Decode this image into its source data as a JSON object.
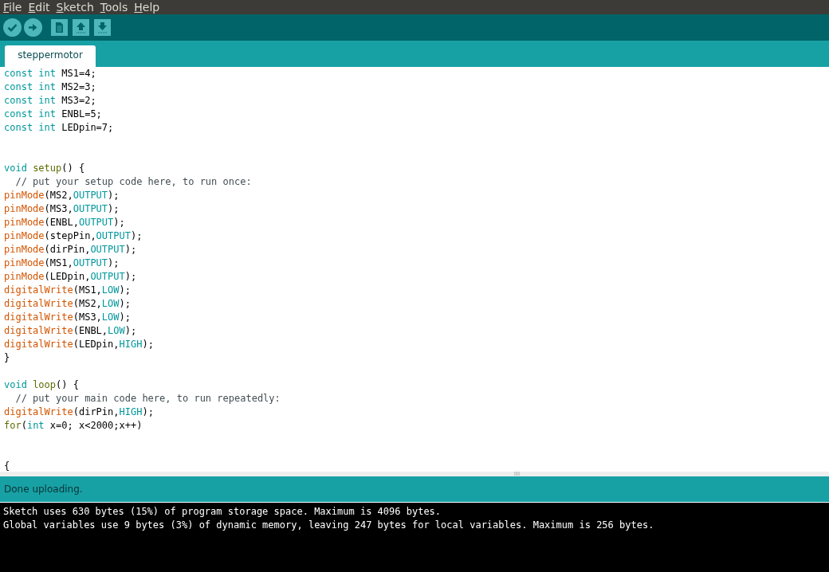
{
  "menu": [
    {
      "label": "File"
    },
    {
      "label": "Edit"
    },
    {
      "label": "Sketch"
    },
    {
      "label": "Tools"
    },
    {
      "label": "Help"
    }
  ],
  "toolbar": [
    {
      "kind": "verify"
    },
    {
      "kind": "upload"
    },
    {
      "kind": "new"
    },
    {
      "kind": "open"
    },
    {
      "kind": "save"
    }
  ],
  "tabs": [
    {
      "label": "steppermotor",
      "selected": true
    }
  ],
  "editor": {
    "lines": [
      {
        "kind": "code",
        "tokens": [
          {
            "kind": "keyword",
            "text": "const int"
          },
          {
            "kind": "plain",
            "text": " MS1=4;"
          }
        ]
      },
      {
        "kind": "code",
        "tokens": [
          {
            "kind": "keyword",
            "text": "const int"
          },
          {
            "kind": "plain",
            "text": " MS2=3;"
          }
        ]
      },
      {
        "kind": "code",
        "tokens": [
          {
            "kind": "keyword",
            "text": "const int"
          },
          {
            "kind": "plain",
            "text": " MS3=2;"
          }
        ]
      },
      {
        "kind": "code",
        "tokens": [
          {
            "kind": "keyword",
            "text": "const int"
          },
          {
            "kind": "plain",
            "text": " ENBL=5;"
          }
        ]
      },
      {
        "kind": "code",
        "tokens": [
          {
            "kind": "keyword",
            "text": "const int"
          },
          {
            "kind": "plain",
            "text": " LEDpin=7;"
          }
        ]
      },
      {
        "kind": "blank"
      },
      {
        "kind": "blank"
      },
      {
        "kind": "code",
        "tokens": [
          {
            "kind": "keyword",
            "text": "void"
          },
          {
            "kind": "structure",
            "text": " setup"
          },
          {
            "kind": "plain",
            "text": "() {"
          }
        ]
      },
      {
        "kind": "code",
        "tokens": [
          {
            "kind": "comment",
            "text": "  // put your setup code here, to run once:"
          }
        ]
      },
      {
        "kind": "code",
        "tokens": [
          {
            "kind": "function",
            "text": "pinMode"
          },
          {
            "kind": "plain",
            "text": "(MS2,"
          },
          {
            "kind": "constant",
            "text": "OUTPUT"
          },
          {
            "kind": "plain",
            "text": ");"
          }
        ]
      },
      {
        "kind": "code",
        "tokens": [
          {
            "kind": "function",
            "text": "pinMode"
          },
          {
            "kind": "plain",
            "text": "(MS3,"
          },
          {
            "kind": "constant",
            "text": "OUTPUT"
          },
          {
            "kind": "plain",
            "text": ");"
          }
        ]
      },
      {
        "kind": "code",
        "tokens": [
          {
            "kind": "function",
            "text": "pinMode"
          },
          {
            "kind": "plain",
            "text": "(ENBL,"
          },
          {
            "kind": "constant",
            "text": "OUTPUT"
          },
          {
            "kind": "plain",
            "text": ");"
          }
        ]
      },
      {
        "kind": "code",
        "tokens": [
          {
            "kind": "function",
            "text": "pinMode"
          },
          {
            "kind": "plain",
            "text": "(stepPin,"
          },
          {
            "kind": "constant",
            "text": "OUTPUT"
          },
          {
            "kind": "plain",
            "text": ");"
          }
        ]
      },
      {
        "kind": "code",
        "tokens": [
          {
            "kind": "function",
            "text": "pinMode"
          },
          {
            "kind": "plain",
            "text": "(dirPin,"
          },
          {
            "kind": "constant",
            "text": "OUTPUT"
          },
          {
            "kind": "plain",
            "text": ");"
          }
        ]
      },
      {
        "kind": "code",
        "tokens": [
          {
            "kind": "function",
            "text": "pinMode"
          },
          {
            "kind": "plain",
            "text": "(MS1,"
          },
          {
            "kind": "constant",
            "text": "OUTPUT"
          },
          {
            "kind": "plain",
            "text": ");"
          }
        ]
      },
      {
        "kind": "code",
        "tokens": [
          {
            "kind": "function",
            "text": "pinMode"
          },
          {
            "kind": "plain",
            "text": "(LEDpin,"
          },
          {
            "kind": "constant",
            "text": "OUTPUT"
          },
          {
            "kind": "plain",
            "text": ");"
          }
        ]
      },
      {
        "kind": "code",
        "tokens": [
          {
            "kind": "function",
            "text": "digitalWrite"
          },
          {
            "kind": "plain",
            "text": "(MS1,"
          },
          {
            "kind": "constant",
            "text": "LOW"
          },
          {
            "kind": "plain",
            "text": ");"
          }
        ]
      },
      {
        "kind": "code",
        "tokens": [
          {
            "kind": "function",
            "text": "digitalWrite"
          },
          {
            "kind": "plain",
            "text": "(MS2,"
          },
          {
            "kind": "constant",
            "text": "LOW"
          },
          {
            "kind": "plain",
            "text": ");"
          }
        ]
      },
      {
        "kind": "code",
        "tokens": [
          {
            "kind": "function",
            "text": "digitalWrite"
          },
          {
            "kind": "plain",
            "text": "(MS3,"
          },
          {
            "kind": "constant",
            "text": "LOW"
          },
          {
            "kind": "plain",
            "text": ");"
          }
        ]
      },
      {
        "kind": "code",
        "tokens": [
          {
            "kind": "function",
            "text": "digitalWrite"
          },
          {
            "kind": "plain",
            "text": "(ENBL,"
          },
          {
            "kind": "constant",
            "text": "LOW"
          },
          {
            "kind": "plain",
            "text": ");"
          }
        ]
      },
      {
        "kind": "code",
        "tokens": [
          {
            "kind": "function",
            "text": "digitalWrite"
          },
          {
            "kind": "plain",
            "text": "(LEDpin,"
          },
          {
            "kind": "constant",
            "text": "HIGH"
          },
          {
            "kind": "plain",
            "text": ");"
          }
        ]
      },
      {
        "kind": "code",
        "tokens": [
          {
            "kind": "plain",
            "text": "}"
          }
        ]
      },
      {
        "kind": "blank"
      },
      {
        "kind": "code",
        "tokens": [
          {
            "kind": "keyword",
            "text": "void"
          },
          {
            "kind": "structure",
            "text": " loop"
          },
          {
            "kind": "plain",
            "text": "() {"
          }
        ]
      },
      {
        "kind": "code",
        "tokens": [
          {
            "kind": "comment",
            "text": "  // put your main code here, to run repeatedly:"
          }
        ]
      },
      {
        "kind": "code",
        "tokens": [
          {
            "kind": "function",
            "text": "digitalWrite"
          },
          {
            "kind": "plain",
            "text": "(dirPin,"
          },
          {
            "kind": "constant",
            "text": "HIGH"
          },
          {
            "kind": "plain",
            "text": ");"
          }
        ]
      },
      {
        "kind": "code",
        "tokens": [
          {
            "kind": "structure",
            "text": "for"
          },
          {
            "kind": "plain",
            "text": "("
          },
          {
            "kind": "keyword",
            "text": "int"
          },
          {
            "kind": "plain",
            "text": " x=0; x<2000;x++)"
          }
        ]
      },
      {
        "kind": "blank"
      },
      {
        "kind": "blank"
      },
      {
        "kind": "code",
        "tokens": [
          {
            "kind": "plain",
            "text": "{"
          }
        ]
      }
    ]
  },
  "status_bar": {
    "message": "Done uploading."
  },
  "console": {
    "lines": [
      "Sketch uses 630 bytes (15%) of program storage space. Maximum is 4096 bytes.",
      "Global variables use 9 bytes (3%) of dynamic memory, leaving 247 bytes for local variables. Maximum is 256 bytes."
    ]
  }
}
